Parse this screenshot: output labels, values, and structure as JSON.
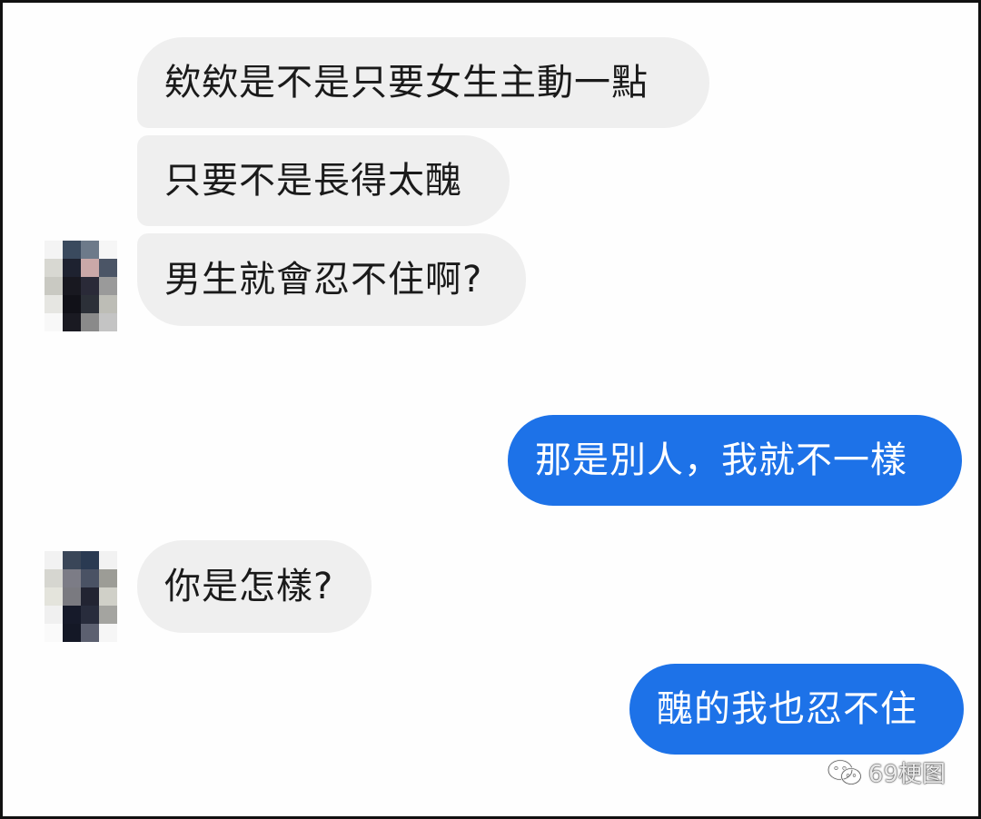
{
  "conversation": {
    "messages": [
      {
        "sender": "other",
        "text": "欸欸是不是只要女生主動一點"
      },
      {
        "sender": "other",
        "text": "只要不是長得太醜"
      },
      {
        "sender": "other",
        "text": "男生就會忍不住啊?"
      },
      {
        "sender": "me",
        "text": "那是別人，我就不一樣"
      },
      {
        "sender": "other",
        "text": "你是怎樣?"
      },
      {
        "sender": "me",
        "text": "醜的我也忍不住"
      }
    ]
  },
  "watermark": {
    "icon": "wechat-icon",
    "text": "69梗图"
  },
  "colors": {
    "incoming_bubble": "#efefef",
    "outgoing_bubble": "#1d72e8",
    "outgoing_text": "#ffffff",
    "incoming_text": "#1a1a1a"
  }
}
